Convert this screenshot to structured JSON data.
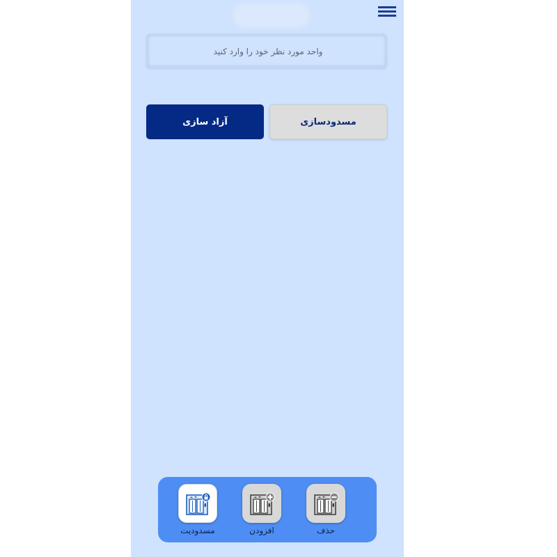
{
  "search": {
    "placeholder": "واحد مورد نظر خود را وارد کنید"
  },
  "actions": {
    "block_label": "مسدودسازی",
    "release_label": "آزاد سازی"
  },
  "bottom_nav": [
    {
      "label": "حذف",
      "icon": "elevator-remove-icon"
    },
    {
      "label": "افزودن",
      "icon": "elevator-add-icon"
    },
    {
      "label": "مسدودیت",
      "icon": "elevator-lock-icon",
      "active": true
    }
  ],
  "colors": {
    "background": "#cfe2fe",
    "primary": "#042a85",
    "secondary_button": "#dddddd",
    "nav_bar": "#4e8ef4"
  }
}
